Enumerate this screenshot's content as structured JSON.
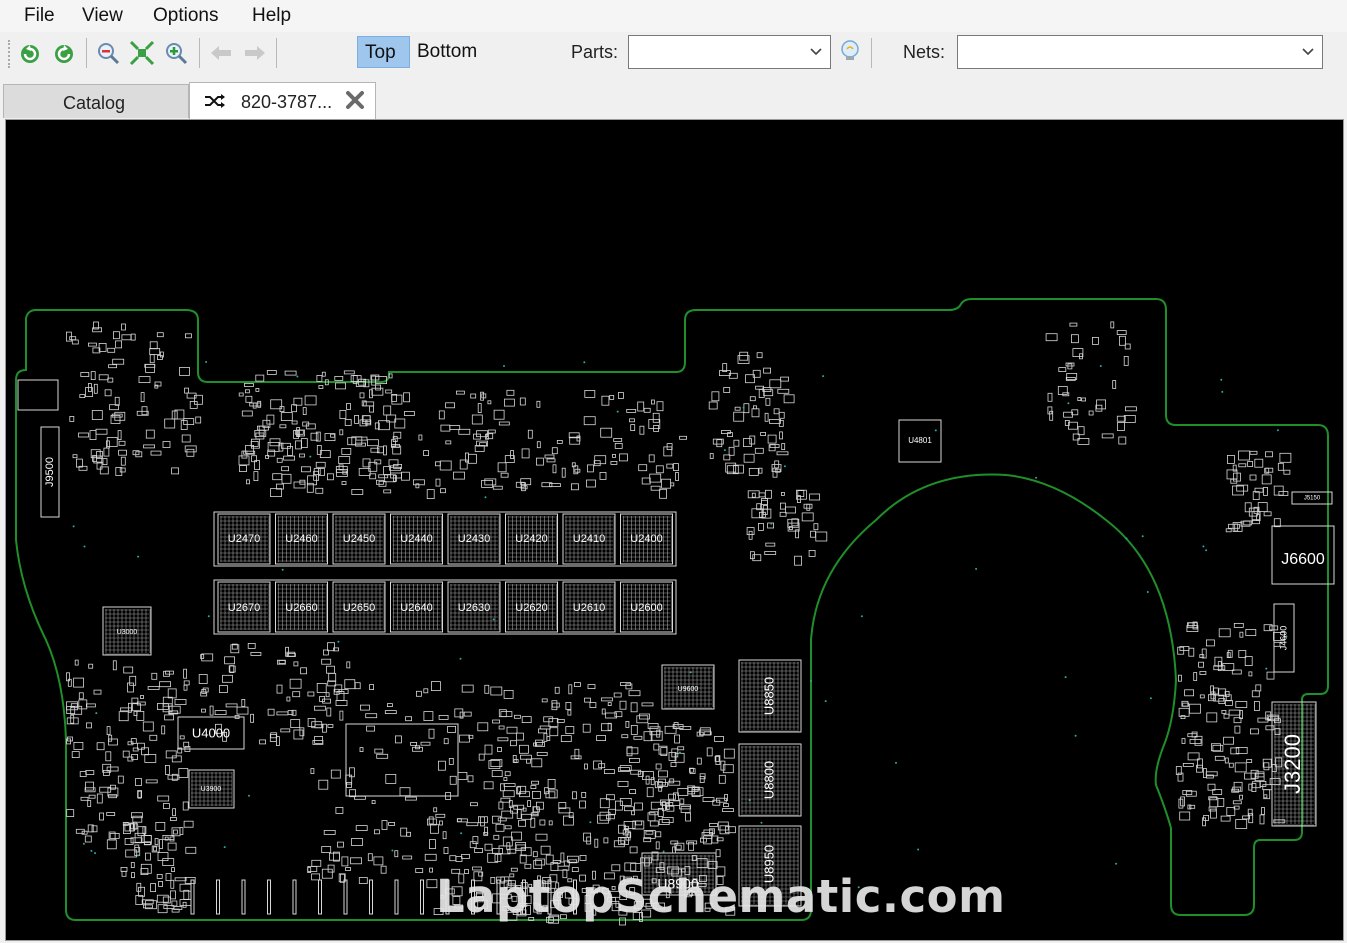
{
  "menu": {
    "file": "File",
    "view": "View",
    "options": "Options",
    "help": "Help"
  },
  "toolbar": {
    "top_label": "Top",
    "bottom_label": "Bottom",
    "parts_label": "Parts:",
    "nets_label": "Nets:",
    "parts_value": "",
    "nets_value": "",
    "icons": [
      "rotate-ccw-icon",
      "rotate-cw-icon",
      "zoom-out-icon",
      "fit-to-window-icon",
      "zoom-in-icon",
      "back-arrow-icon",
      "forward-arrow-icon",
      "lightbulb-icon"
    ]
  },
  "tabs": [
    {
      "label": "Catalog",
      "active": false
    },
    {
      "label": "820-3787...",
      "active": true
    }
  ],
  "board": {
    "chips": {
      "u2470": "U2470",
      "u2460": "U2460",
      "u2450": "U2450",
      "u2440": "U2440",
      "u2430": "U2430",
      "u2420": "U2420",
      "u2410": "U2410",
      "u2400": "U2400",
      "u2670": "U2670",
      "u2660": "U2660",
      "u2650": "U2650",
      "u2640": "U2640",
      "u2630": "U2630",
      "u2620": "U2620",
      "u2610": "U2610",
      "u2600": "U2600",
      "u3000": "U3000",
      "u4000": "U4000",
      "u3900": "U3900",
      "u9600": "U9600",
      "u8850": "U8850",
      "u8800": "U8800",
      "u8950": "U8950",
      "u8900": "U8900",
      "u4801": "U4801",
      "j9500": "J9500",
      "j6600": "J6600",
      "j4600": "J4600",
      "j3200": "J3200",
      "j5150": "J5150"
    },
    "colors": {
      "background": "#000000",
      "outline": "#1f8f2a",
      "silkscreen": "#d8d8d8",
      "via": "#2aa9a9"
    }
  },
  "watermark": "LaptopSchematic.com"
}
